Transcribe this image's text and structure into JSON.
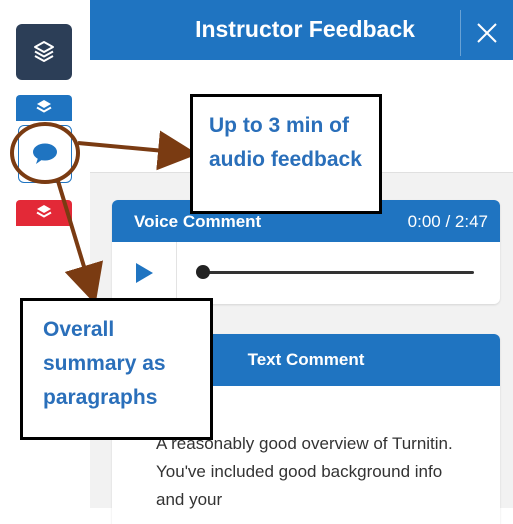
{
  "panel": {
    "title": "Instructor Feedback",
    "close_label": "×"
  },
  "voice_comment": {
    "title": "Voice Comment",
    "time": "0:00 / 2:47",
    "progress_fraction": 0.0
  },
  "text_comment": {
    "title": "Text Comment",
    "body": "A reasonably good overview of Turnitin. You've included good background info and your"
  },
  "annotations": {
    "audio": "Up to 3 min of audio feedback",
    "summary": "Overall summary as paragraphs"
  },
  "colors": {
    "accent": "#1f74c1",
    "rail_dark": "#2c3e57",
    "rail_red": "#e32937",
    "annotation_text": "#2a6fba",
    "annotation_arrow": "#7a3b12"
  },
  "icons": {
    "rail": [
      "layers-icon",
      "layers-icon",
      "comment-icon",
      "layers-icon"
    ],
    "player": "play-icon",
    "close": "close-icon"
  }
}
